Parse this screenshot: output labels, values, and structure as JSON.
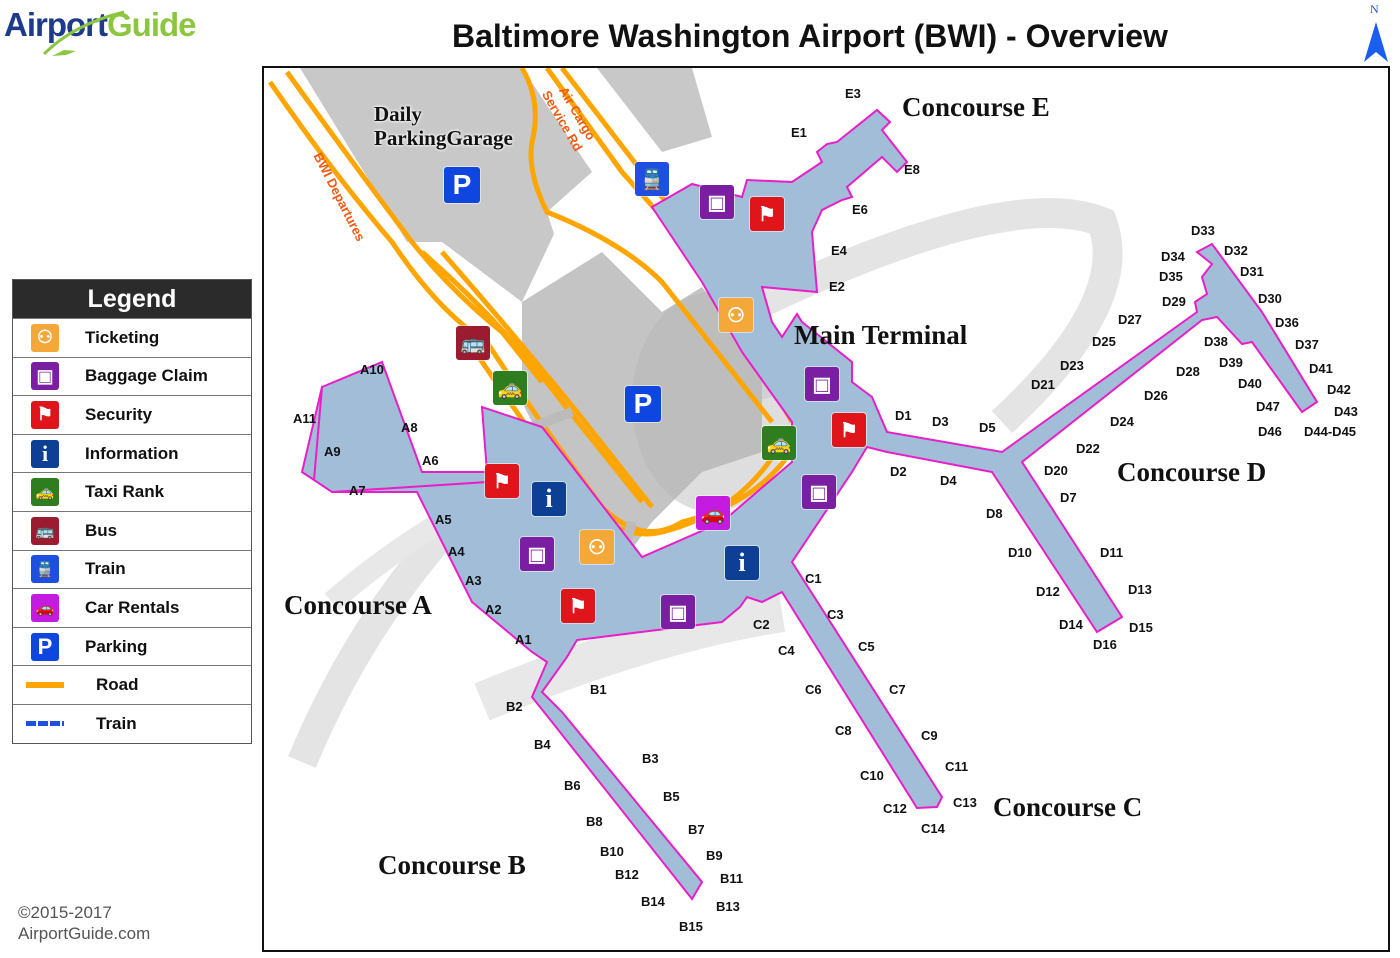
{
  "header": {
    "logo_airport": "Airport",
    "logo_guide": "Guide",
    "title": "Baltimore Washington Airport (BWI) - Overview",
    "north_label": "N"
  },
  "colors": {
    "ticketing": "#f5a83a",
    "baggage": "#7b1fa2",
    "security": "#e0141b",
    "information": "#0d3f95",
    "taxi": "#2e7d1f",
    "bus": "#9b1b30",
    "train": "#1f4fe0",
    "car_rentals": "#c41be0",
    "parking": "#1046e0",
    "road": "#ffa500",
    "train_line": "#1f4fe0",
    "terminal_fill": "#a2bdd8",
    "terminal_outline": "#e81ec8",
    "garage_fill": "#c8c8c8"
  },
  "legend": {
    "title": "Legend",
    "items": [
      {
        "icon": "ticketing-icon",
        "label": "Ticketing"
      },
      {
        "icon": "baggage-claim-icon",
        "label": "Baggage Claim"
      },
      {
        "icon": "security-icon",
        "label": "Security"
      },
      {
        "icon": "information-icon",
        "label": "Information"
      },
      {
        "icon": "taxi-icon",
        "label": "Taxi Rank"
      },
      {
        "icon": "bus-icon",
        "label": "Bus"
      },
      {
        "icon": "train-icon",
        "label": "Train"
      },
      {
        "icon": "car-rental-icon",
        "label": "Car Rentals"
      },
      {
        "icon": "parking-icon",
        "label": "Parking"
      },
      {
        "icon": "road-line",
        "label": "Road"
      },
      {
        "icon": "train-line",
        "label": "Train"
      }
    ]
  },
  "map": {
    "areas": {
      "concourse_a": "Concourse A",
      "concourse_b": "Concourse B",
      "concourse_c": "Concourse C",
      "concourse_d": "Concourse D",
      "concourse_e": "Concourse E",
      "main_terminal": "Main Terminal",
      "garage_line1": "Daily",
      "garage_line2": "ParkingGarage"
    },
    "roads": {
      "bwi_departures": "BWI Departures",
      "air_cargo_1": "Air Cargo",
      "air_cargo_2": "Service Rd"
    },
    "gates": {
      "A": [
        "A1",
        "A2",
        "A3",
        "A4",
        "A5",
        "A6",
        "A7",
        "A8",
        "A9",
        "A10",
        "A11"
      ],
      "B": [
        "B1",
        "B2",
        "B3",
        "B4",
        "B5",
        "B6",
        "B7",
        "B8",
        "B9",
        "B10",
        "B11",
        "B12",
        "B13",
        "B14",
        "B15"
      ],
      "C": [
        "C1",
        "C2",
        "C3",
        "C4",
        "C5",
        "C6",
        "C7",
        "C8",
        "C9",
        "C10",
        "C11",
        "C12",
        "C13",
        "C14"
      ],
      "D": [
        "D1",
        "D2",
        "D3",
        "D4",
        "D5",
        "D7",
        "D8",
        "D10",
        "D11",
        "D12",
        "D13",
        "D14",
        "D15",
        "D16",
        "D20",
        "D21",
        "D22",
        "D23",
        "D24",
        "D25",
        "D26",
        "D27",
        "D28",
        "D29",
        "D30",
        "D31",
        "D32",
        "D33",
        "D34",
        "D35",
        "D36",
        "D37",
        "D38",
        "D39",
        "D40",
        "D41",
        "D42",
        "D43",
        "D44-D45",
        "D46",
        "D47"
      ],
      "E": [
        "E1",
        "E2",
        "E3",
        "E4",
        "E6",
        "E8"
      ]
    },
    "poi_glyphs": {
      "parking": "P",
      "information": "i"
    }
  },
  "footer": {
    "copyright": "©2015-2017",
    "site": "AirportGuide.com"
  }
}
